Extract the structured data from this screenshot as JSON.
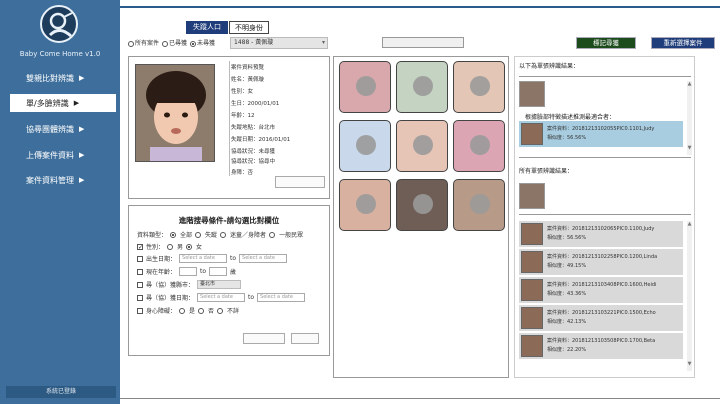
{
  "app": {
    "title": "Baby Come Home v1.0",
    "logout": "系統已登錄"
  },
  "sidebar": {
    "items": [
      {
        "label": "雙親比對辨識"
      },
      {
        "label": "單/多臉辨識"
      },
      {
        "label": "協尋團體辨識"
      },
      {
        "label": "上傳案件資料"
      },
      {
        "label": "案件資料管理"
      }
    ],
    "active": 1
  },
  "tabs": {
    "lost": "失蹤人口",
    "unknown": "不明身份"
  },
  "filter": {
    "all": "所有案件",
    "found": "已尋獲",
    "not_found": "未尋獲",
    "selected_case": "1488 - 黃佩璇"
  },
  "buttons": {
    "mark_found": "標記尋獲",
    "reselect": "重新選擇案件"
  },
  "case_info": {
    "fields": [
      "案件資料預覽",
      "姓名：黃佩璇",
      "性別：女",
      "生日：2000/01/01",
      "年齡：12",
      "失蹤地點：台北市",
      "失蹤日期：2016/01/01",
      "協尋狀況：未尋獲",
      "協尋狀況：協尋中",
      "身障：否"
    ]
  },
  "search": {
    "title": "進階搜尋條件-請勾選比對欄位",
    "type_label": "資料類型：",
    "type_all": "全部",
    "type_lost": "失蹤",
    "type_elder": "迷童／身障者",
    "type_public": "一般民眾",
    "gender_label": "性別：",
    "male": "男",
    "female": "女",
    "birth_label": "出生日期：",
    "date_placeholder": "Select a date",
    "to": "to",
    "age_label": "現在年齡：",
    "age_unit": "歲",
    "city_label": "尋（協）獲縣市：",
    "city_value": "臺北市",
    "date_label": "尋（協）獲日期：",
    "disability_label": "身心障礙：",
    "yes": "是",
    "no": "否",
    "unknown": "不詳"
  },
  "results": {
    "same_title": "以下為單張辨識結果：",
    "same_sub": "根據臉部特徵描述推測最適合者：",
    "same_cards": [
      {
        "id": "案件資料：20181213102055PIC0.1101,Judy",
        "sim": "相似度：56.56%"
      }
    ],
    "all_title": "所有單張辨識結果：",
    "cards": [
      {
        "id": "案件資料：20181213102065PIC0.1100,Judy",
        "sim": "相似度：56.56%"
      },
      {
        "id": "案件資料：20181213102258PIC0.1200,Linda",
        "sim": "相似度：49.15%"
      },
      {
        "id": "案件資料：20181213103408PIC0.1600,Heidi",
        "sim": "相似度：43.36%"
      },
      {
        "id": "案件資料：20181213103221PIC0.1500,Echo",
        "sim": "相似度：42.13%"
      },
      {
        "id": "案件資料：20181213103508PIC0.1700,Beta",
        "sim": "相似度：22.20%"
      }
    ]
  },
  "colors": {
    "sidebar": "#3e6f9c",
    "tab_active": "#1f3d7a",
    "mark_btn": "#1c4b1c",
    "highlight": "#a9cde0"
  }
}
